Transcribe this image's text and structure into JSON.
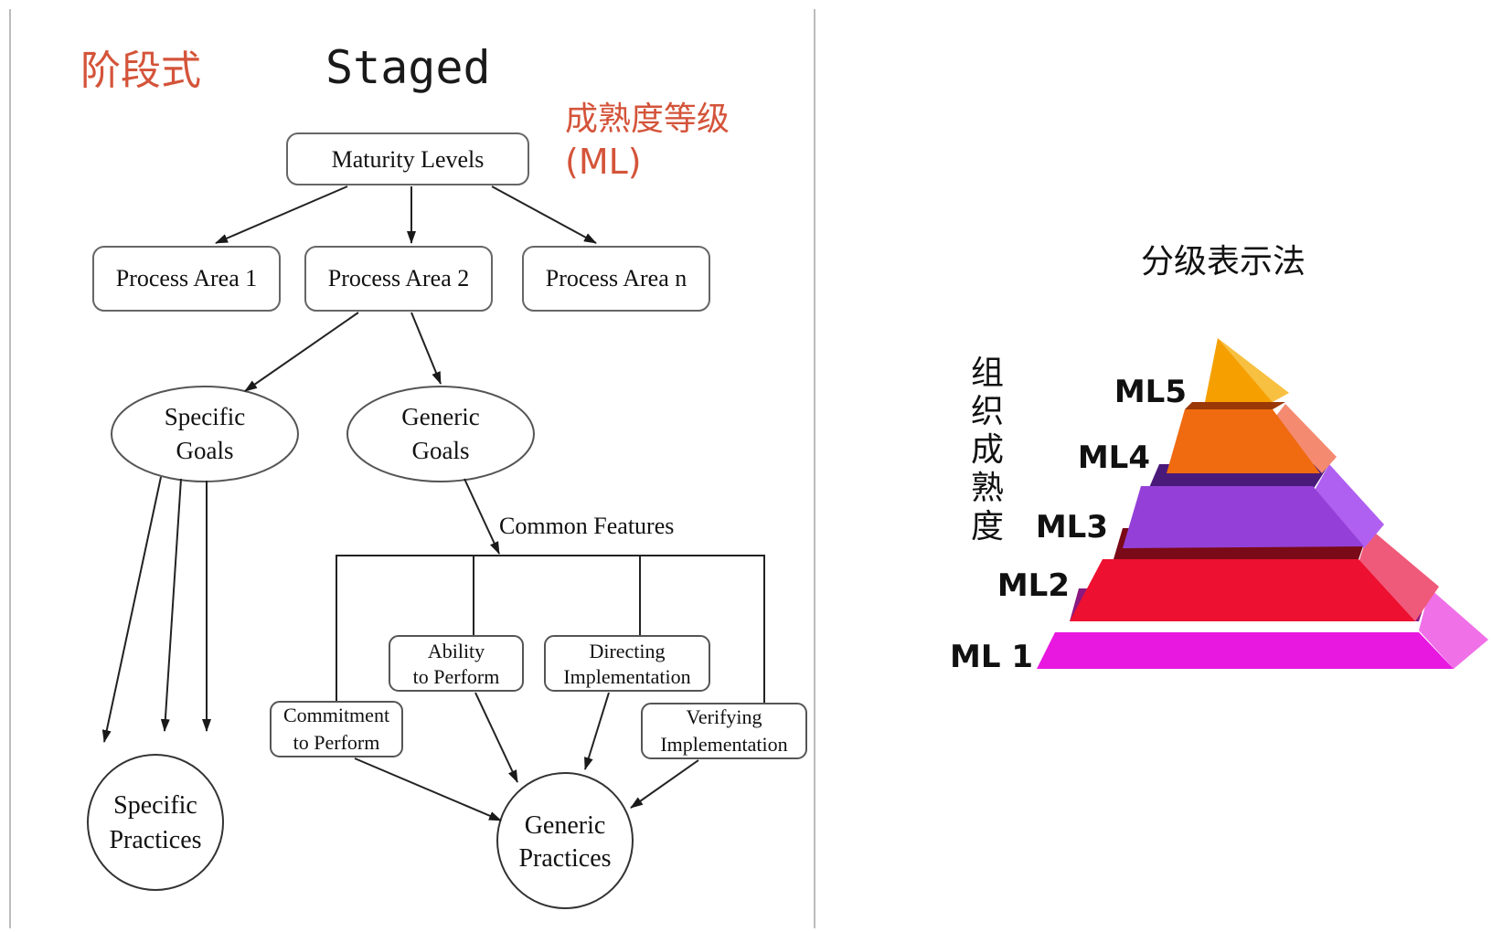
{
  "staged": {
    "cn_label": "阶段式",
    "title": "Staged",
    "ml_cn": "成熟度等级",
    "ml_abbr": "(ML)"
  },
  "nodes": {
    "maturity_levels": "Maturity Levels",
    "process_areas": [
      "Process Area 1",
      "Process Area 2",
      "Process Area n"
    ],
    "specific_goals": [
      "Specific",
      "Goals"
    ],
    "generic_goals": [
      "Generic",
      "Goals"
    ],
    "common_features": "Common Features",
    "commitment": [
      "Commitment",
      "to Perform"
    ],
    "ability": [
      "Ability",
      "to Perform"
    ],
    "directing": [
      "Directing",
      "Implementation"
    ],
    "verifying": [
      "Verifying",
      "Implementation"
    ],
    "specific_practices": [
      "Specific",
      "Practices"
    ],
    "generic_practices": [
      "Generic",
      "Practices"
    ]
  },
  "pyramid": {
    "title": "分级表示法",
    "vertical_label": [
      "组",
      "织",
      "成",
      "熟",
      "度"
    ],
    "levels": [
      {
        "label": "ML5",
        "color": "#f5a000"
      },
      {
        "label": "ML4",
        "color": "#f06a10"
      },
      {
        "label": "ML3",
        "color": "#9440d8"
      },
      {
        "label": "ML2",
        "color": "#ee1030"
      },
      {
        "label": "ML 1",
        "color": "#e818e0"
      }
    ]
  },
  "colors": {
    "annotation": "#d4543a",
    "line": "#222222",
    "box_border": "#666666"
  }
}
